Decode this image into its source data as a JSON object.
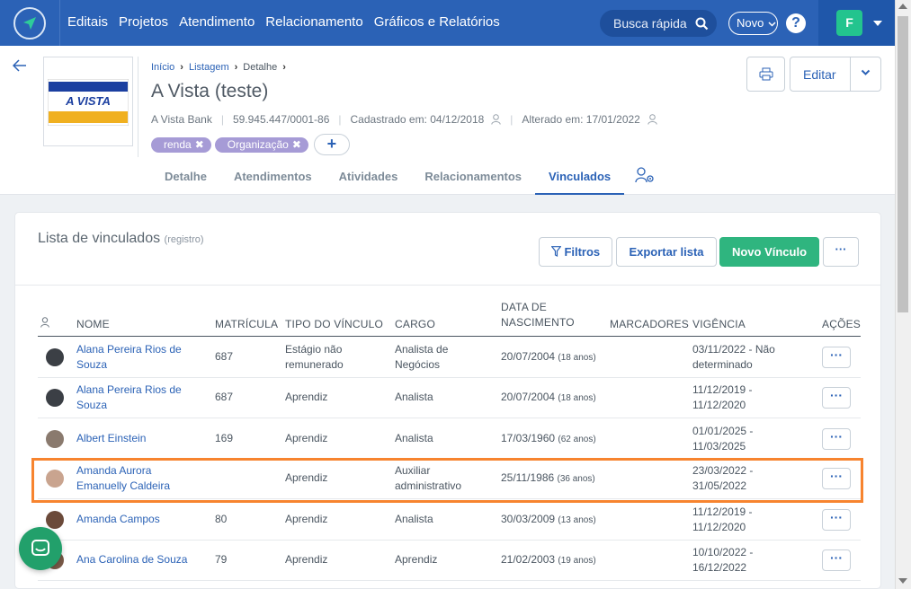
{
  "nav": {
    "items": [
      "Editais",
      "Projetos",
      "Atendimento",
      "Relacionamento",
      "Gráficos e Relatórios"
    ],
    "search_label": "Busca rápida",
    "novo_label": "Novo",
    "help_label": "?",
    "user_initial": "F"
  },
  "breadcrumb": {
    "home": "Início",
    "list": "Listagem",
    "current": "Detalhe"
  },
  "entity": {
    "logo_text": "A VISTA",
    "title": "A Vista (teste)",
    "bank": "A Vista Bank",
    "cnpj": "59.945.447/0001-86",
    "created": "Cadastrado em: 04/12/2018",
    "updated": "Alterado em: 17/01/2022",
    "tags": [
      "renda",
      "Organização"
    ]
  },
  "actions": {
    "edit_label": "Editar"
  },
  "tabs": [
    "Detalhe",
    "Atendimentos",
    "Atividades",
    "Relacionamentos",
    "Vinculados"
  ],
  "active_tab": "Vinculados",
  "panel": {
    "title": "Lista de vinculados",
    "subtitle": "(registro)",
    "filters_label": "Filtros",
    "export_label": "Exportar lista",
    "new_label": "Novo Vínculo",
    "more_label": "···"
  },
  "table": {
    "headers": {
      "name": "NOME",
      "reg": "MATRÍCULA",
      "type": "TIPO DO VÍNCULO",
      "role": "CARGO",
      "birth_line1": "DATA DE",
      "birth_line2": "NASCIMENTO",
      "markers": "MARCADORES",
      "validity": "VIGÊNCIA",
      "actions": "AÇÕES"
    },
    "rows": [
      {
        "name1": "Alana Pereira Rios de",
        "name2": "Souza",
        "reg": "687",
        "type1": "Estágio não",
        "type2": "remunerado",
        "role1": "Analista de",
        "role2": "Negócios",
        "birth": "20/07/2004",
        "age": "(18 anos)",
        "val1": "03/11/2022 - Não",
        "val2": "determinado",
        "avatar_color": "#3b3f45"
      },
      {
        "name1": "Alana Pereira Rios de",
        "name2": "Souza",
        "reg": "687",
        "type1": "Aprendiz",
        "type2": "",
        "role1": "Analista",
        "role2": "",
        "birth": "20/07/2004",
        "age": "(18 anos)",
        "val1": "11/12/2019 -",
        "val2": "11/12/2020",
        "avatar_color": "#3b3f45"
      },
      {
        "name1": "Albert Einstein",
        "name2": "",
        "reg": "169",
        "type1": "Aprendiz",
        "type2": "",
        "role1": "Analista",
        "role2": "",
        "birth": "17/03/1960",
        "age": "(62 anos)",
        "val1": "01/01/2025 -",
        "val2": "11/03/2025",
        "avatar_color": "#8a7a6e"
      },
      {
        "name1": "Amanda Aurora",
        "name2": "Emanuelly Caldeira",
        "reg": "",
        "type1": "Aprendiz",
        "type2": "",
        "role1": "Auxiliar",
        "role2": "administrativo",
        "birth": "25/11/1986",
        "age": "(36 anos)",
        "val1": "23/03/2022 -",
        "val2": "31/05/2022",
        "avatar_color": "#c9a48f"
      },
      {
        "name1": "Amanda Campos",
        "name2": "",
        "reg": "80",
        "type1": "Aprendiz",
        "type2": "",
        "role1": "Analista",
        "role2": "",
        "birth": "30/03/2009",
        "age": "(13 anos)",
        "val1": "11/12/2019 -",
        "val2": "11/12/2020",
        "avatar_color": "#6b4a3a"
      },
      {
        "name1": "Ana Carolina de Souza",
        "name2": "",
        "reg": "79",
        "type1": "Aprendiz",
        "type2": "",
        "role1": "Aprendiz",
        "role2": "",
        "birth": "21/02/2003",
        "age": "(19 anos)",
        "val1": "10/10/2022 -",
        "val2": "16/12/2022",
        "avatar_color": "#7a5a48"
      }
    ],
    "row_action_label": "···"
  },
  "colors": {
    "primary": "#2b62b6",
    "success": "#2fb57f",
    "tag": "#a69bd6",
    "highlight": "#f7842f"
  }
}
